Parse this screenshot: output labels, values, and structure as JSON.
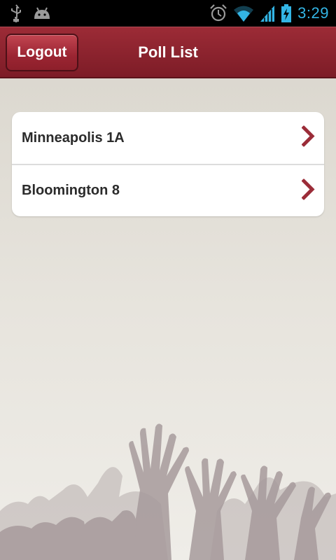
{
  "status_bar": {
    "time": "3:29",
    "icons": [
      "usb-icon",
      "android-icon",
      "alarm-icon",
      "wifi-icon",
      "signal-icon",
      "battery-charging-icon"
    ]
  },
  "header": {
    "logout_label": "Logout",
    "title": "Poll List"
  },
  "poll_list": {
    "items": [
      {
        "label": "Minneapolis 1A"
      },
      {
        "label": "Bloomington 8"
      }
    ]
  },
  "colors": {
    "header": "#8c2330",
    "accent_chevron": "#9b2c38",
    "time_color": "#33b5e5",
    "background": "#e3dfd8"
  }
}
